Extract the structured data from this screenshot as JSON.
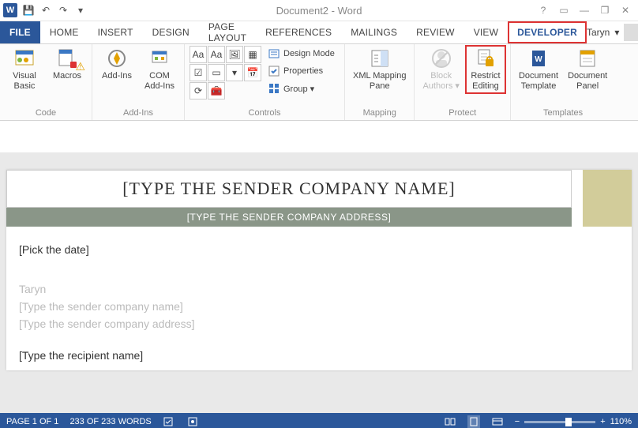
{
  "title": "Document2 - Word",
  "qat": {
    "save": "💾",
    "undo": "↶",
    "redo": "↷",
    "customize": "▾"
  },
  "sysbtns": {
    "help": "?",
    "ribbonopts": "▭",
    "min": "—",
    "restore": "❐",
    "close": "✕"
  },
  "tabs": {
    "file": "FILE",
    "home": "HOME",
    "insert": "INSERT",
    "design": "DESIGN",
    "pagelayout": "PAGE LAYOUT",
    "references": "REFERENCES",
    "mailings": "MAILINGS",
    "review": "REVIEW",
    "view": "VIEW",
    "developer": "DEVELOPER"
  },
  "user": {
    "name": "Taryn",
    "menu": "▾"
  },
  "ribbon": {
    "code": {
      "label": "Code",
      "vb": "Visual\nBasic",
      "macros": "Macros"
    },
    "addins": {
      "label": "Add-Ins",
      "addins": "Add-Ins",
      "com": "COM\nAdd-Ins"
    },
    "controls": {
      "label": "Controls",
      "design": "Design Mode",
      "props": "Properties",
      "group": "Group ▾"
    },
    "mapping": {
      "label": "Mapping",
      "xml": "XML Mapping\nPane"
    },
    "protect": {
      "label": "Protect",
      "block": "Block\nAuthors ▾",
      "restrict": "Restrict\nEditing"
    },
    "templates": {
      "label": "Templates",
      "doctpl": "Document\nTemplate",
      "docpanel": "Document\nPanel"
    }
  },
  "doc": {
    "sender_company": "[TYPE THE SENDER COMPANY NAME]",
    "sender_address": "[TYPE THE SENDER COMPANY ADDRESS]",
    "pick_date": "[Pick the date]",
    "signer": "Taryn",
    "sender_company2": "[Type the sender company name]",
    "sender_address2": "[Type the sender company address]",
    "recipient": "[Type the recipient name]"
  },
  "status": {
    "page": "PAGE 1 OF 1",
    "words": "233 OF 233 WORDS",
    "zoom": "110%",
    "zoom_minus": "−",
    "zoom_plus": "+"
  }
}
